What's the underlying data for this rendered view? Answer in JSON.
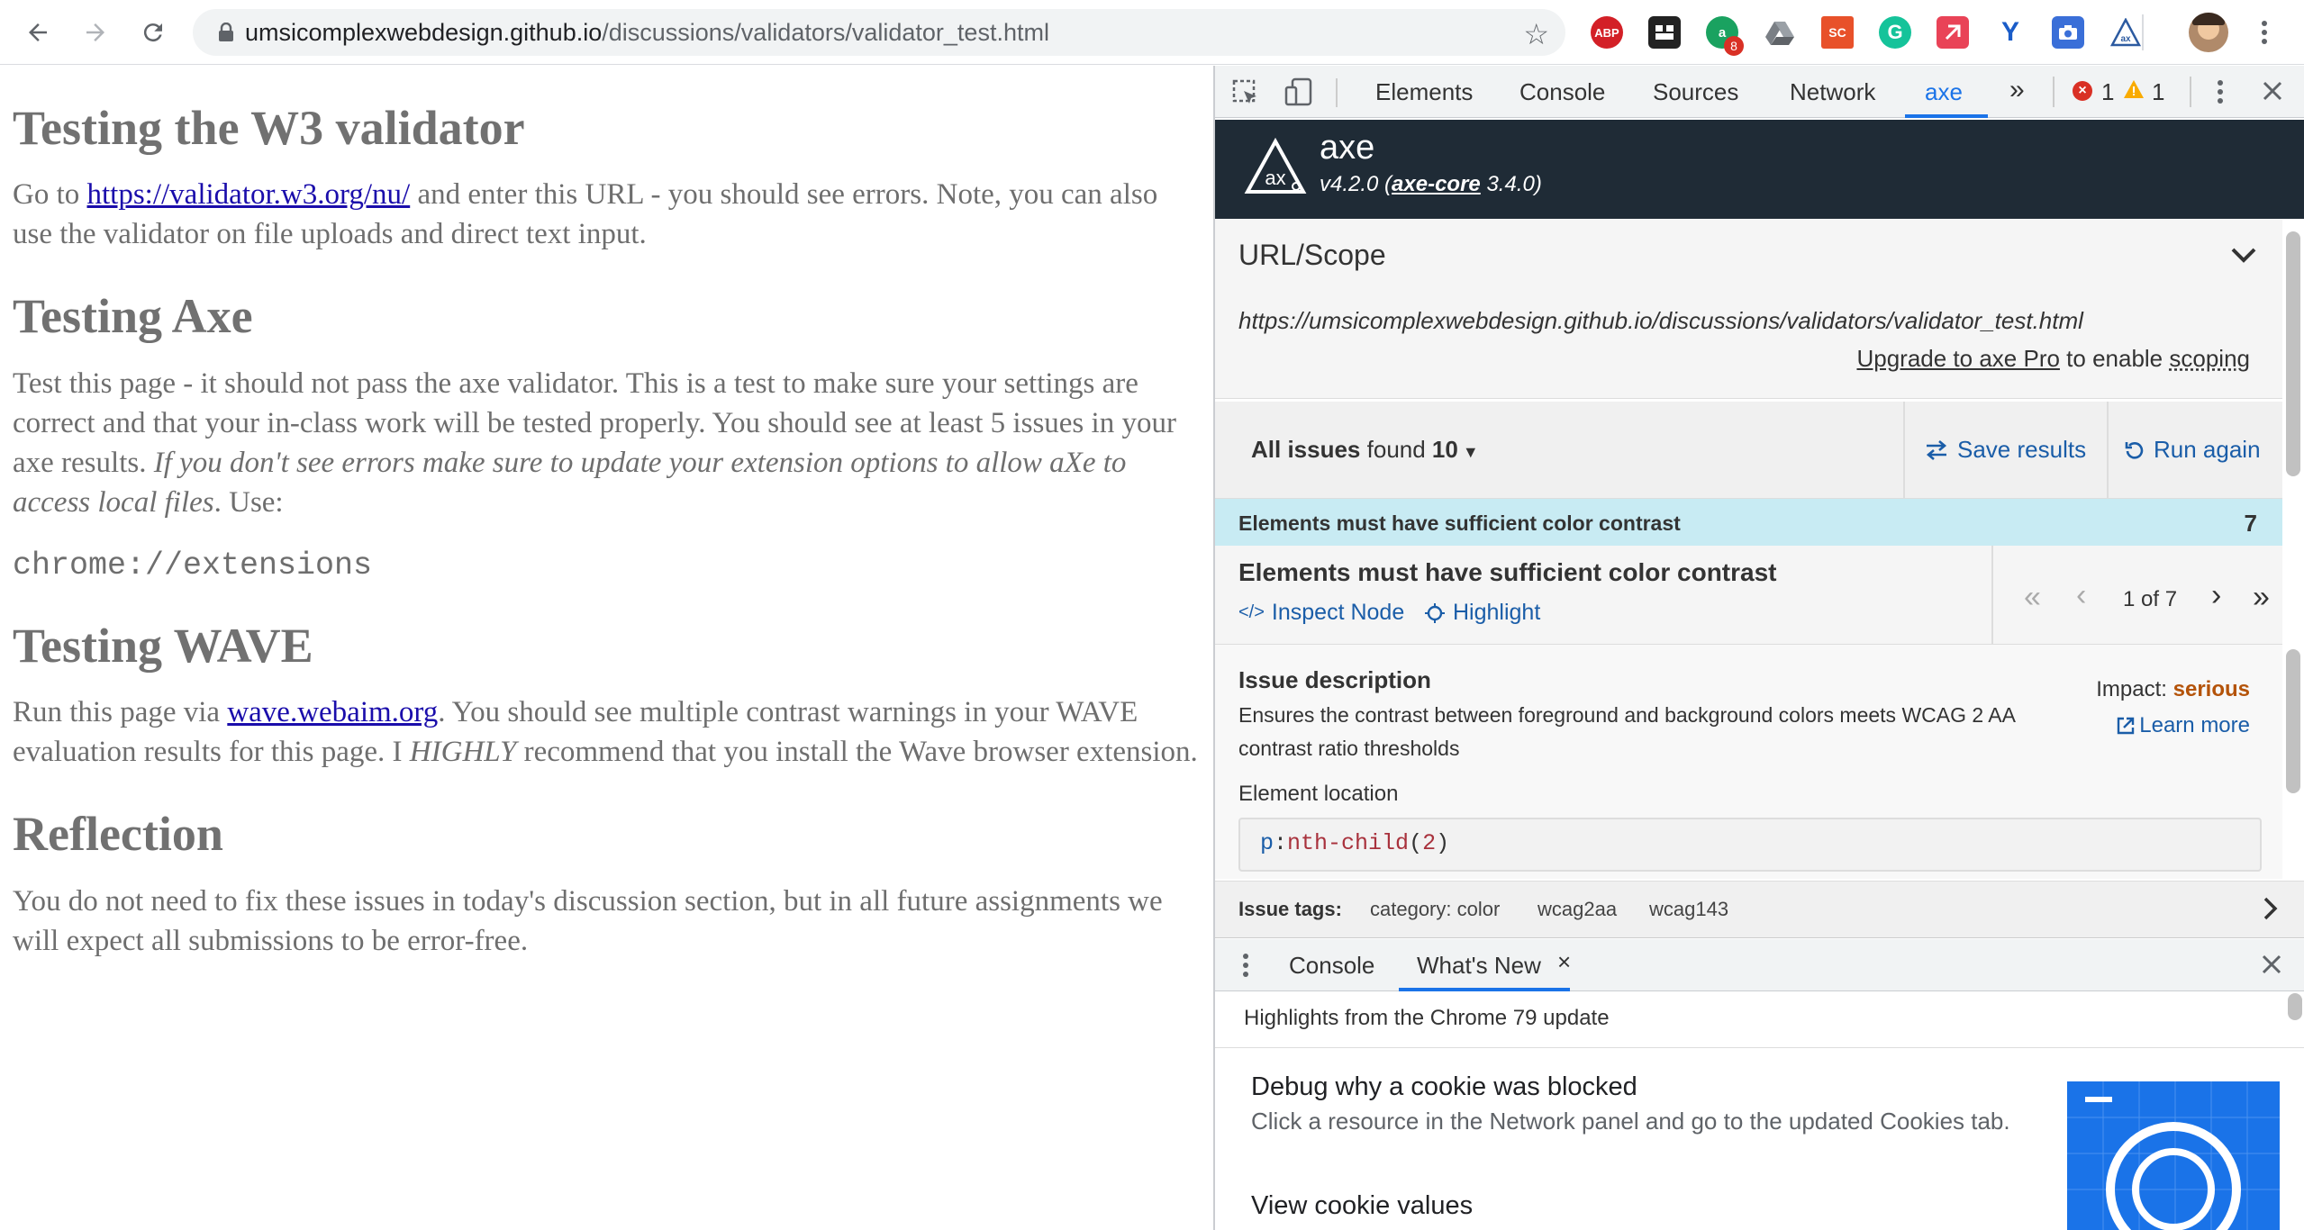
{
  "browser": {
    "url_domain": "umsicomplexwebdesign.github.io",
    "url_path": "/discussions/validators/validator_test.html",
    "extensions": [
      {
        "name": "adblock-plus-icon",
        "label": "ABP",
        "color": "#d32027"
      },
      {
        "name": "sc-extension-icon",
        "label": "SC",
        "color": "#e8512a"
      },
      {
        "name": "badge-count",
        "label": "8"
      }
    ]
  },
  "page": {
    "h1_validator": "Testing the W3 validator",
    "p1_pre": "Go to ",
    "p1_link": "https://validator.w3.org/nu/",
    "p1_post": " and enter this URL - you should see errors. Note, you can also use the validator on file uploads and direct text input.",
    "h1_axe": "Testing Axe",
    "p2_main": "Test this page - it should not pass the axe validator. This is a test to make sure your settings are correct and that your in-class work will be tested properly. You should see at least 5 issues in your axe results. ",
    "p2_em": "If you don't see errors make sure to update your extension options to allow aXe to access local files",
    "p2_post": ". Use:",
    "code": "chrome://extensions",
    "h1_wave": "Testing WAVE",
    "p3_pre": "Run this page via ",
    "p3_link": "wave.webaim.org",
    "p3_mid": ". You should see multiple contrast warnings in your WAVE evaluation results for this page. I ",
    "p3_em": "HIGHLY",
    "p3_post": " recommend that you install the Wave browser extension.",
    "h1_reflection": "Reflection",
    "p4": "You do not need to fix these issues in today's discussion section, but in all future assignments we will expect all submissions to be error-free."
  },
  "devtools": {
    "tabs": [
      "Elements",
      "Console",
      "Sources",
      "Network",
      "axe"
    ],
    "more": "»",
    "error_count": "1",
    "warning_count": "1",
    "active_tab": "axe"
  },
  "axe": {
    "name": "axe",
    "version_pre": "v4.2.0 (",
    "core_link": "axe-core",
    "core_version": " 3.4.0)",
    "scope_title": "URL/Scope",
    "scope_url": "https://umsicomplexwebdesign.github.io/discussions/validators/validator_test.html",
    "upgrade_link": "Upgrade to axe Pro",
    "upgrade_mid": " to enable ",
    "upgrade_scoping": "scoping",
    "all_issues": "All issues",
    "found": " found ",
    "found_count": "10",
    "save_results": "Save results",
    "run_again": "Run again",
    "category_label": "Elements must have sufficient color contrast",
    "category_count": "7",
    "issue_title": "Elements must have sufficient color contrast",
    "inspect_node": "Inspect Node",
    "highlight": "Highlight",
    "pager": "1 of 7",
    "issue_description_title": "Issue description",
    "issue_description": "Ensures the contrast between foreground and background colors meets WCAG 2 AA contrast ratio thresholds",
    "impact_label": "Impact: ",
    "impact_value": "serious",
    "learn_more": "Learn more",
    "element_location_title": "Element location",
    "selector_p": "p",
    "selector_colon": ":",
    "selector_fn": "nth-child",
    "selector_open": "(",
    "selector_num": "2",
    "selector_close": ")",
    "tags_label": "Issue tags:",
    "tags": [
      "category: color",
      "wcag2aa",
      "wcag143"
    ]
  },
  "drawer": {
    "tabs": [
      "Console",
      "What's New"
    ],
    "highlights": "Highlights from the Chrome 79 update",
    "item_title": "Debug why a cookie was blocked",
    "item_desc": "Click a resource in the Network panel and go to the updated Cookies tab.",
    "item2_title": "View cookie values"
  }
}
